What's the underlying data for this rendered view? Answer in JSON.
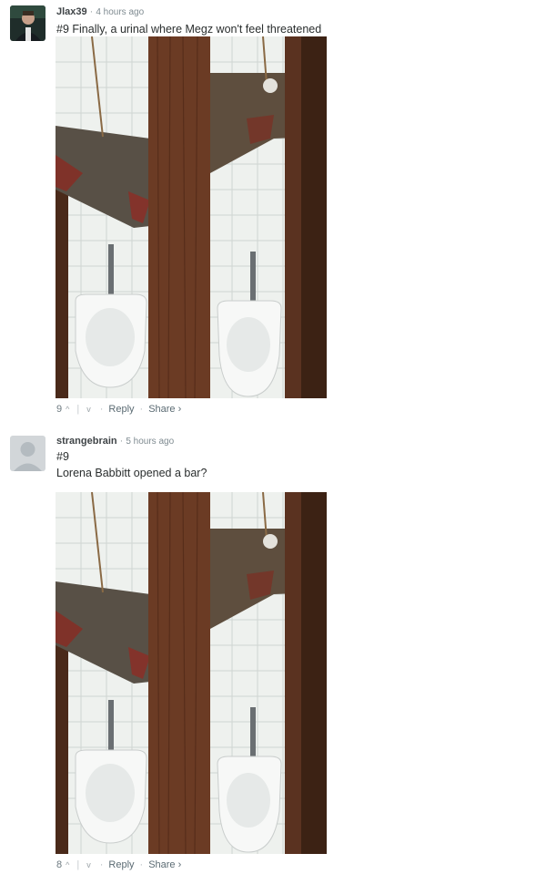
{
  "comments": [
    {
      "author": "Jlax39",
      "time": "4 hours ago",
      "lines": [
        "#9 Finally, a urinal where Megz won't feel threatened"
      ],
      "votes": "9",
      "upvote_icon": "^",
      "downvote_icon": "v",
      "reply": "Reply",
      "share": "Share ›"
    },
    {
      "author": "strangebrain",
      "time": "5 hours ago",
      "lines": [
        "#9",
        "Lorena Babbitt opened a bar?"
      ],
      "votes": "8",
      "upvote_icon": "^",
      "downvote_icon": "v",
      "reply": "Reply",
      "share": "Share ›"
    }
  ],
  "colors": {
    "author": "#3f4447",
    "meta": "#7f8b91",
    "text": "#2a2e2e",
    "wood": "#6b3b24",
    "tile": "#ecefec"
  }
}
